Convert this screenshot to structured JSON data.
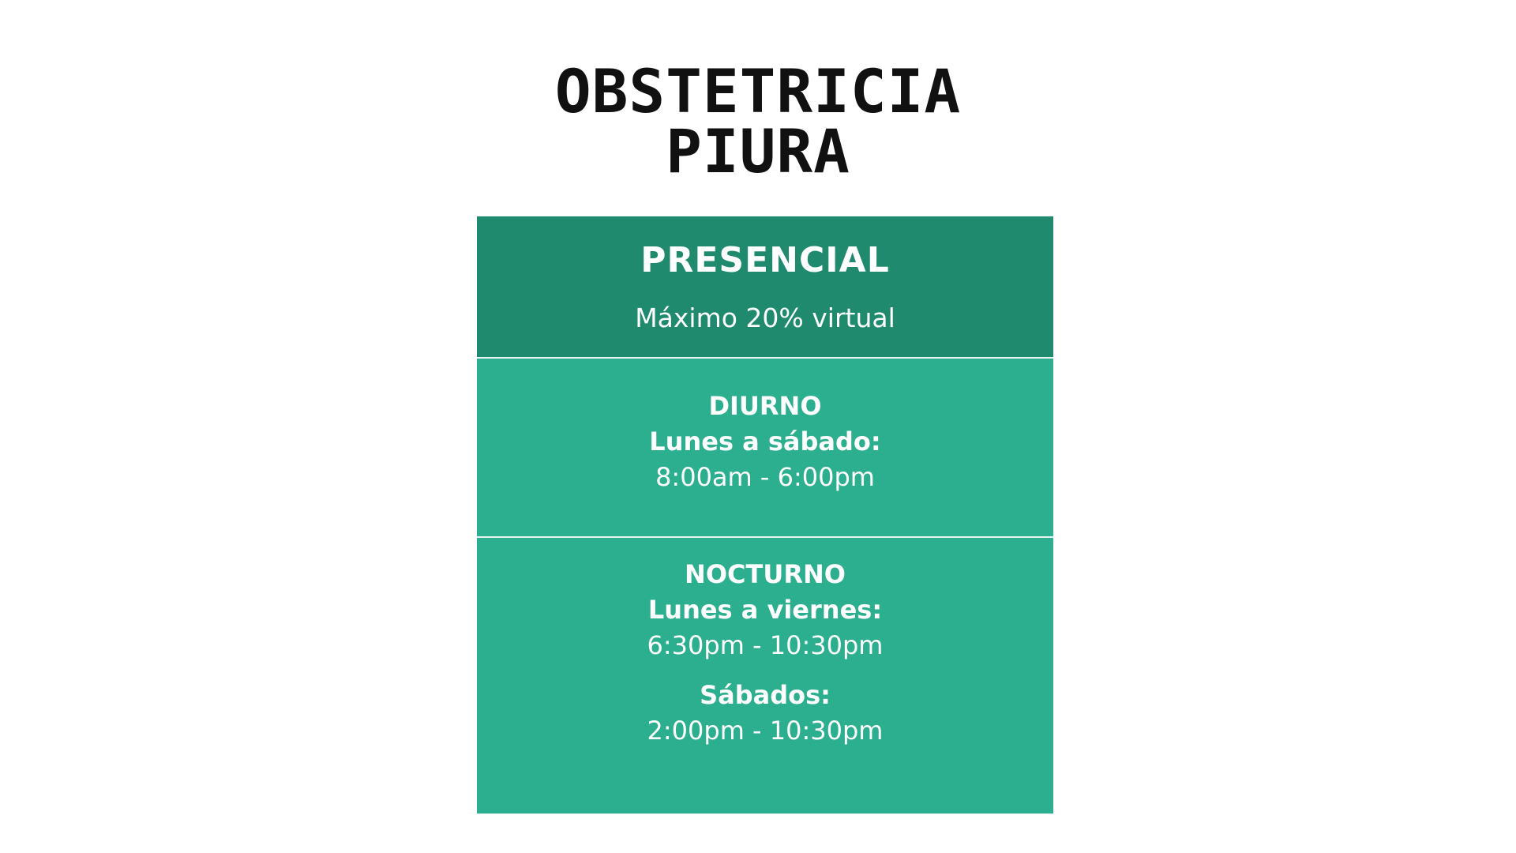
{
  "title": {
    "line1": "OBSTETRICIA",
    "line2": "PIURA"
  },
  "card": {
    "header": {
      "title": "PRESENCIAL",
      "subtitle": "Máximo 20% virtual"
    },
    "diurno": {
      "title": "DIURNO",
      "days": "Lunes a sábado:",
      "hours": "8:00am - 6:00pm"
    },
    "nocturno": {
      "title": "NOCTURNO",
      "days": "Lunes a viernes:",
      "hours": "6:30pm - 10:30pm",
      "days2": "Sábados:",
      "hours2": "2:00pm - 10:30pm"
    }
  },
  "colors": {
    "header_bg": "#1f8a6e",
    "section_bg": "#2baf8e",
    "divider": "#e8f5f0",
    "title_text": "#111111"
  }
}
